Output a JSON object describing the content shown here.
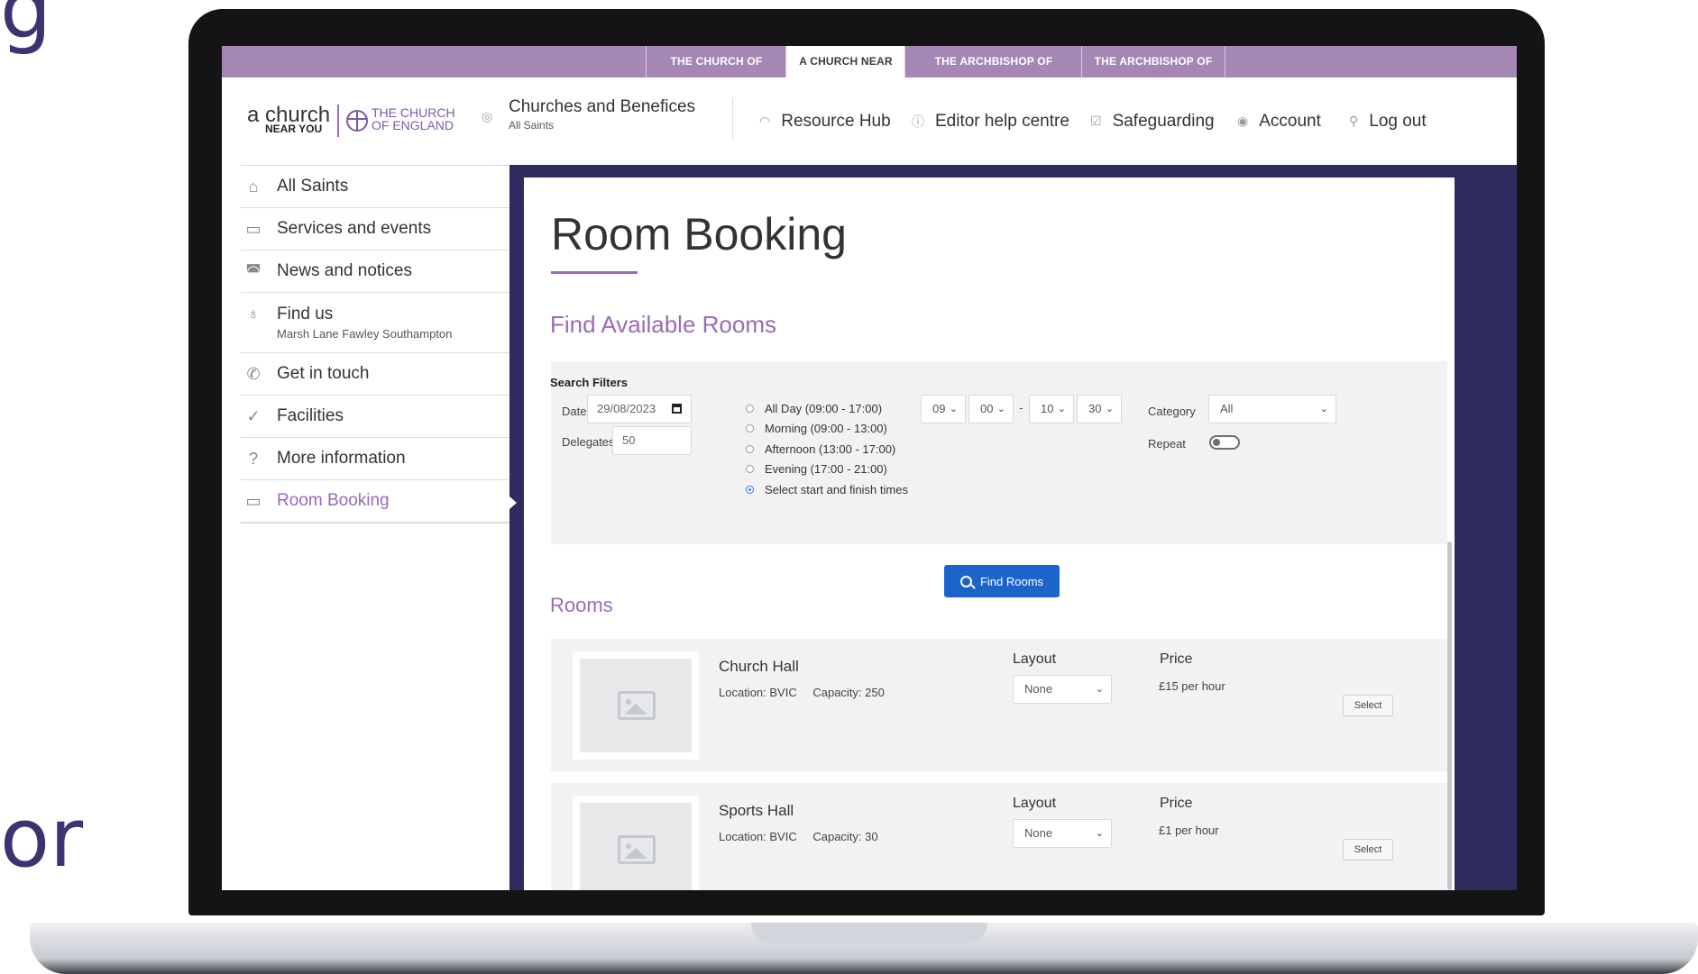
{
  "edge_text": [
    "g",
    "or"
  ],
  "top_tabs": [
    {
      "label": "THE CHURCH OF ENGLAND",
      "active": false
    },
    {
      "label": "A CHURCH NEAR YOU",
      "active": true
    },
    {
      "label": "THE ARCHBISHOP OF CANTERBURY",
      "active": false
    },
    {
      "label": "THE ARCHBISHOP OF YORK",
      "active": false
    }
  ],
  "logo": {
    "main": "a church",
    "sub": "NEAR YOU",
    "coe_line1": "THE CHURCH",
    "coe_line2": "OF ENGLAND"
  },
  "header": {
    "church_link": {
      "title": "Churches and Benefices",
      "subtitle": "All Saints",
      "icon": "target-icon"
    },
    "nav": [
      {
        "label": "Resource Hub",
        "icon": "rainbow-icon"
      },
      {
        "label": "Editor help centre",
        "icon": "help-circle-icon"
      },
      {
        "label": "Safeguarding",
        "icon": "check-square-icon"
      },
      {
        "label": "Account",
        "icon": "account-icon"
      },
      {
        "label": "Log out",
        "icon": "key-icon"
      }
    ]
  },
  "sidebar": [
    {
      "label": "All Saints",
      "icon": "home-icon",
      "active": false
    },
    {
      "label": "Services and events",
      "icon": "calendar-icon",
      "active": false
    },
    {
      "label": "News and notices",
      "icon": "broadcast-icon",
      "active": false
    },
    {
      "label": "Find us",
      "sub": "Marsh Lane Fawley Southampton",
      "icon": "map-pin-icon",
      "active": false
    },
    {
      "label": "Get in touch",
      "icon": "phone-icon",
      "active": false
    },
    {
      "label": "Facilities",
      "icon": "check-circle-icon",
      "active": false
    },
    {
      "label": "More information",
      "icon": "question-circle-icon",
      "active": false
    },
    {
      "label": "Room Booking",
      "icon": "calendar-icon",
      "active": true
    }
  ],
  "main": {
    "title": "Room Booking",
    "find_title": "Find Available Rooms",
    "filters": {
      "heading": "Search Filters",
      "date_label": "Date",
      "date_value": "29/08/2023",
      "delegates_label": "Delegates",
      "delegates_value": "50",
      "time_options": [
        {
          "label": "All Day (09:00 - 17:00)",
          "checked": false
        },
        {
          "label": "Morning (09:00 - 13:00)",
          "checked": false
        },
        {
          "label": "Afternoon (13:00 - 17:00)",
          "checked": false
        },
        {
          "label": "Evening (17:00 - 21:00)",
          "checked": false
        },
        {
          "label": "Select start and finish times",
          "checked": true
        }
      ],
      "start_hour": "09",
      "start_min": "00",
      "time_separator": "-",
      "end_hour": "10",
      "end_min": "30",
      "category_label": "Category",
      "category_value": "All",
      "repeat_label": "Repeat",
      "repeat_on": false
    },
    "find_button": "Find Rooms",
    "rooms_title": "Rooms",
    "rooms": [
      {
        "name": "Church Hall",
        "location": "Location: BVIC",
        "capacity": "Capacity: 250",
        "layout_label": "Layout",
        "layout_value": "None",
        "price_label": "Price",
        "price": "£15 per hour",
        "select_label": "Select"
      },
      {
        "name": "Sports Hall",
        "location": "Location: BVIC",
        "capacity": "Capacity: 30",
        "layout_label": "Layout",
        "layout_value": "None",
        "price_label": "Price",
        "price": "£1 per hour",
        "select_label": "Select"
      }
    ]
  },
  "colors": {
    "purple_bar": "#a487b5",
    "accent_purple": "#9b6ab6",
    "navy": "#2e2b5f",
    "button_blue": "#1b64c9"
  }
}
